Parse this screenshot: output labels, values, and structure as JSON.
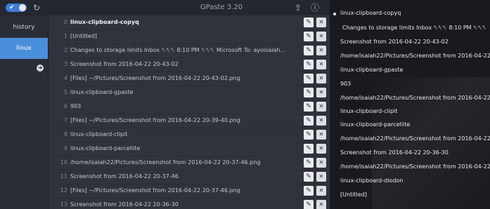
{
  "header": {
    "title": "GPaste 3.20",
    "toggle_check": "✔",
    "icons": {
      "refresh": "↻",
      "upload": "⇪",
      "info": "ⓘ",
      "menu": "☰"
    }
  },
  "sidebar": {
    "items": [
      {
        "label": "history"
      },
      {
        "label": "linux",
        "active": true
      }
    ],
    "add_icon": "➜"
  },
  "list": {
    "rows": [
      {
        "index": "0",
        "text": "linux-clipboard-copyq",
        "bold": true
      },
      {
        "index": "1",
        "text": "[Untitled]"
      },
      {
        "index": "2",
        "text": "Changes to storage limits Inbox ␤␤␤ 8:10 PM ␤␤␤ Microsoft To: ayoisaiah..."
      },
      {
        "index": "3",
        "text": "Screenshot from 2016-04-22 20-43-02"
      },
      {
        "index": "4",
        "text": "[Files] ~/Pictures/Screenshot from 2016-04-22 20-43-02.png"
      },
      {
        "index": "5",
        "text": "linux-clipboard-gpaste"
      },
      {
        "index": "6",
        "text": "903"
      },
      {
        "index": "7",
        "text": "[Files] ~/Pictures/Screenshot from 2016-04-22 20-39-40.png"
      },
      {
        "index": "8",
        "text": "linux-clipboard-clipit"
      },
      {
        "index": "9",
        "text": "linux-clipboard-parcellite"
      },
      {
        "index": "10",
        "text": "/home/isaiah22/Pictures/Screenshot from 2016-04-22 20-37-46.png"
      },
      {
        "index": "11",
        "text": "Screenshot from 2016-04-22 20-37-46"
      },
      {
        "index": "12",
        "text": "[Files] ~/Pictures/Screenshot from 2016-04-22 20-37-46.png"
      },
      {
        "index": "13",
        "text": "Screenshot from 2016-04-22 20-36-30"
      }
    ],
    "edit_icon": "✎",
    "delete_icon": "✕"
  },
  "popup": {
    "items": [
      {
        "text": "linux-clipboard-copyq",
        "selected": true
      },
      {
        "text": "Changes to storage limits Inbox ␤␤␤ 8:10 PM ␤␤␤"
      },
      {
        "text": "Screenshot from 2016-04-22 20-43-02"
      },
      {
        "text": "/home/isaiah22/Pictures/Screenshot from 2016-04-22"
      },
      {
        "text": "linux-clipboard-gpaste"
      },
      {
        "text": "903"
      },
      {
        "text": "/home/isaiah22/Pictures/Screenshot from 2016-04-22"
      },
      {
        "text": "linux-clipboard-clipit"
      },
      {
        "text": "linux-clipboard-parcellite"
      },
      {
        "text": "/home/isaiah22/Pictures/Screenshot from 2016-04-22"
      },
      {
        "text": "Screenshot from 2016-04-22 20-36-30"
      },
      {
        "text": "/home/isaiah22/Pictures/Screenshot from 2016-04-22"
      },
      {
        "text": "linux-clipboard-diodon"
      },
      {
        "text": "[Untitled]"
      }
    ]
  },
  "colors": {
    "accent": "#4b8fdc",
    "background": "#2b2e36",
    "popup": "#181a1f"
  }
}
